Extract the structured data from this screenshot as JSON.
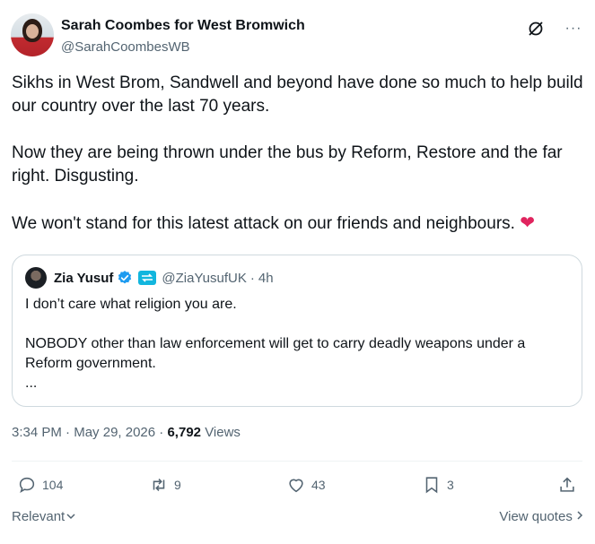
{
  "author": {
    "name": "Sarah Coombes for West Bromwich",
    "handle": "@SarahCoombesWB"
  },
  "icons": {
    "grok": "grok-icon",
    "more": "more-icon"
  },
  "tweet": {
    "paragraph1": "Sikhs in West Brom, Sandwell and beyond have done so much to help build our country over the last 70 years.",
    "paragraph2": "Now they are being thrown under the bus by Reform, Restore and the far right. Disgusting.",
    "paragraph3": "We won't stand for this latest attack on our friends and neighbours.",
    "emoji": "❤"
  },
  "quote": {
    "name": "Zia Yusuf",
    "handle": "@ZiaYusufUK",
    "dot": "·",
    "time": "4h",
    "line1": "I don’t care what religion you are.",
    "line2": "NOBODY other than law enforcement will get to carry deadly weapons under a Reform government.",
    "ellipsis": "..."
  },
  "meta": {
    "time": "3:34 PM",
    "sep": "·",
    "date": "May 29, 2026",
    "views_count": "6,792",
    "views_label": "Views"
  },
  "actions": {
    "replies": "104",
    "reposts": "9",
    "likes": "43",
    "bookmarks": "3"
  },
  "footer": {
    "sort_label": "Relevant",
    "view_quotes": "View quotes"
  },
  "colors": {
    "text": "#0f1419",
    "secondary": "#536471",
    "verified": "#1d9bf0",
    "heart": "#e0245e",
    "border": "#cfd9de"
  }
}
